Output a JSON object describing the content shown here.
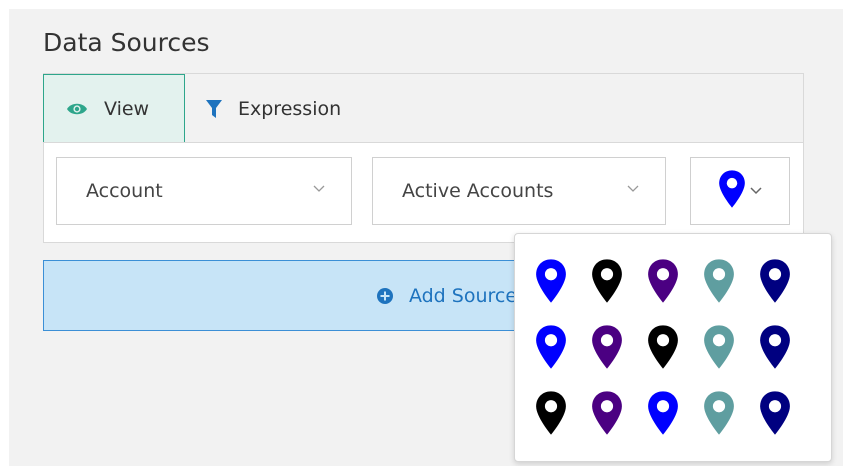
{
  "title": "Data Sources",
  "tabs": [
    {
      "label": "View",
      "icon": "eye-icon",
      "active": true
    },
    {
      "label": "Expression",
      "icon": "filter-icon",
      "active": false
    }
  ],
  "selects": {
    "entity": "Account",
    "view": "Active Accounts"
  },
  "pin_button": {
    "icon": "map-pin-icon",
    "color": "#0000ff"
  },
  "add_button": {
    "label": "Add Source",
    "icon": "plus-circle-icon"
  },
  "colors": {
    "accent_green": "#2ea68b",
    "add_bg": "#c7e4f7",
    "add_text": "#1e73be"
  },
  "pin_grid": [
    [
      "#0000ff",
      "#000000",
      "#4b0082",
      "#5f9ea0",
      "#000080"
    ],
    [
      "#0000ff",
      "#4b0082",
      "#000000",
      "#5f9ea0",
      "#000080"
    ],
    [
      "#000000",
      "#4b0082",
      "#0000ff",
      "#5f9ea0",
      "#000080"
    ]
  ]
}
